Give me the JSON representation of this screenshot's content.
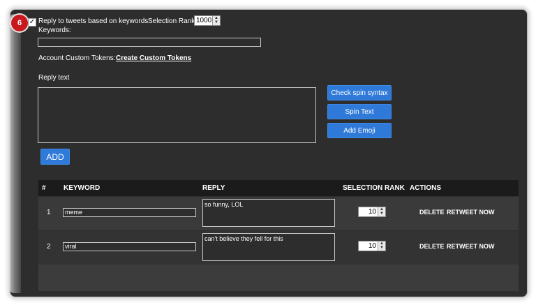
{
  "step_badge": "6",
  "settings": {
    "reply_checkbox_checked": true,
    "reply_label": "Reply to tweets based on keywords",
    "selection_rank_label": "Selection Rank",
    "selection_rank_value": "1000",
    "keywords_label": "Keywords:",
    "keywords_value": "",
    "custom_tokens_label": "Account Custom Tokens:",
    "custom_tokens_link": "Create Custom Tokens",
    "reply_text_label": "Reply text",
    "reply_text_value": ""
  },
  "buttons": {
    "check_spin": "Check spin syntax",
    "spin_text": "Spin Text",
    "add_emoji": "Add Emoji",
    "add": "ADD"
  },
  "table": {
    "headers": [
      "#",
      "KEYWORD",
      "REPLY",
      "SELECTION RANK",
      "ACTIONS"
    ],
    "rows": [
      {
        "num": "1",
        "keyword": "meme",
        "reply": "so funny, LOL",
        "rank": "10",
        "delete": "DELETE",
        "retweet": "RETWEET NOW"
      },
      {
        "num": "2",
        "keyword": "viral",
        "reply": "can't believe they fell for this",
        "rank": "10",
        "delete": "DELETE",
        "retweet": "RETWEET NOW"
      }
    ]
  },
  "colors": {
    "panel_bg": "#2d2d2d",
    "accent_blue": "#2f7ad9",
    "badge_red": "#c8191e",
    "header_bg": "#1b1b1b"
  }
}
